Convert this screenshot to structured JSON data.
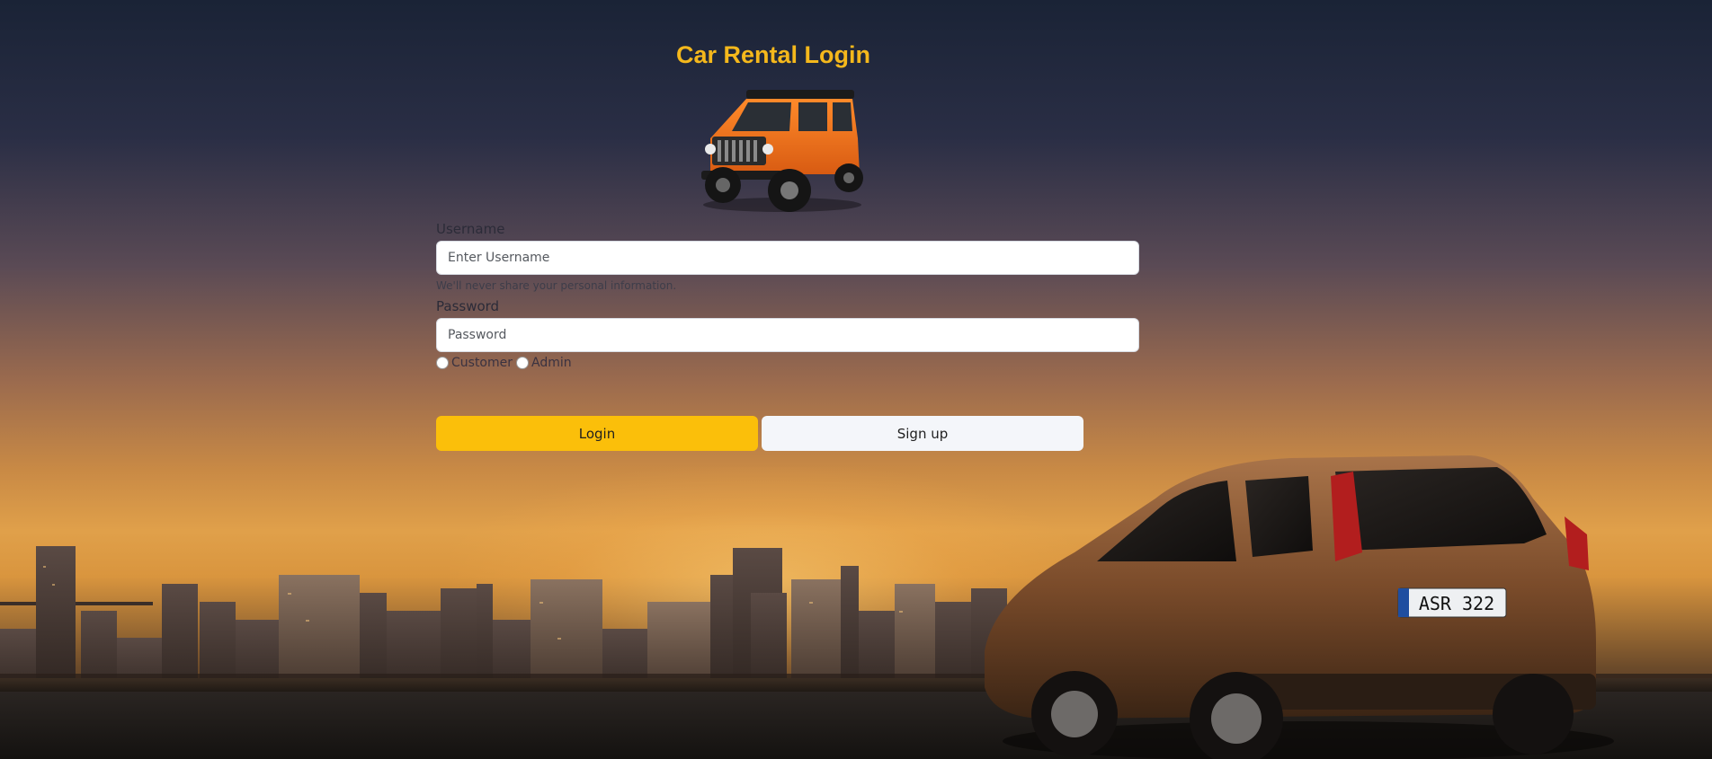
{
  "header": {
    "title": "Car Rental Login"
  },
  "form": {
    "username_label": "Username",
    "username_placeholder": "Enter Username",
    "username_help": "We'll never share your personal information.",
    "password_label": "Password",
    "password_placeholder": "Password",
    "role_options": [
      "Customer",
      "Admin"
    ],
    "login_label": "Login",
    "signup_label": "Sign up"
  },
  "colors": {
    "title": "#f5b81c",
    "login_button": "#fbbf0a",
    "signup_button": "#f4f6fa"
  },
  "images": {
    "logo": "orange-jeep",
    "background": "city-skyline-at-sunset-with-brown-suv",
    "license_plate": "ASR 322"
  }
}
